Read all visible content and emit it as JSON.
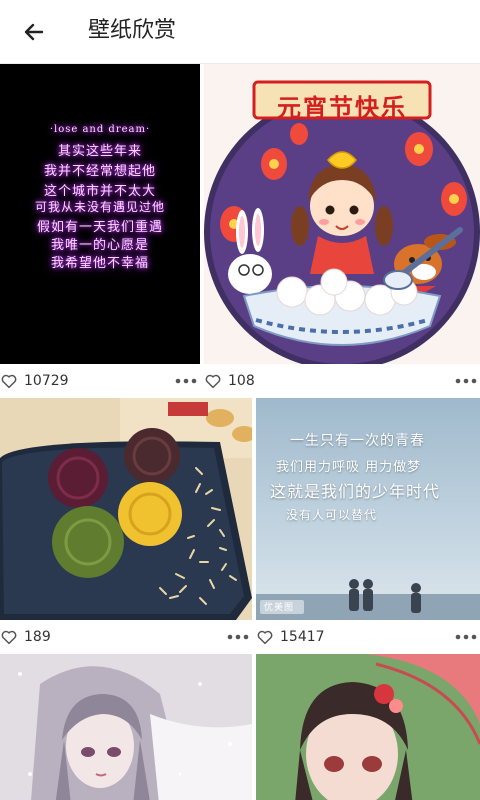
{
  "app_bar": {
    "title": "壁纸欣赏",
    "back_icon": "arrow-left-icon"
  },
  "colors": {
    "background": "#ffffff",
    "text": "#222222",
    "icon": "#555555"
  },
  "cards": [
    {
      "likes": "10729",
      "image": {
        "kind": "neon-quote-wallpaper",
        "heading": "·lose and dream·",
        "lines": [
          "其实这些年来",
          "我并不经常想起他",
          "这个城市并不太大",
          "可我从未没有遇见过他",
          "假如有一天我们重遇",
          "我唯一的心愿是",
          "我希望他不幸福"
        ]
      }
    },
    {
      "likes": "108",
      "image": {
        "kind": "lantern-festival-illustration",
        "banner": "元宵节快乐"
      }
    },
    {
      "likes": "189",
      "image": {
        "kind": "mooncake-calligraphy-photo"
      }
    },
    {
      "likes": "15417",
      "image": {
        "kind": "youth-quote-photo",
        "lines": [
          "一生只有一次的青春",
          "我们用力呼吸 用力做梦",
          "这就是我们的少年时代",
          "没有人可以替代"
        ],
        "watermark": "优美图"
      }
    },
    {
      "likes": "",
      "image": {
        "kind": "anime-girl-snow"
      }
    },
    {
      "likes": "",
      "image": {
        "kind": "anime-girl-umbrella"
      }
    }
  ]
}
